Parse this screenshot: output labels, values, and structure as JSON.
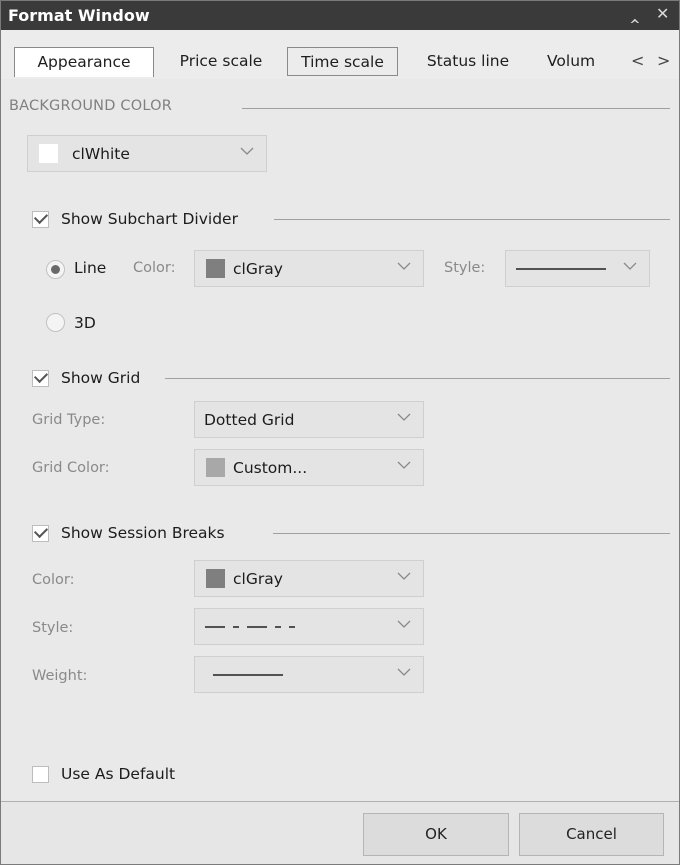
{
  "window": {
    "title": "Format Window"
  },
  "titlebar_icons": [
    "chevron-up-icon",
    "close-icon"
  ],
  "tabs": [
    {
      "label": "Appearance",
      "state": "active"
    },
    {
      "label": "Price scale",
      "state": "normal"
    },
    {
      "label": "Time scale",
      "state": "boxed"
    },
    {
      "label": "Status line",
      "state": "normal"
    },
    {
      "label": "Volum",
      "state": "normal"
    }
  ],
  "tab_nav_icons": [
    "chevron-left-icon",
    "chevron-right-icon"
  ],
  "background": {
    "caption": "BACKGROUND COLOR",
    "color_value": "clWhite",
    "swatch_color": "#ffffff"
  },
  "subchart_divider": {
    "label": "Show Subchart Divider",
    "checked": true,
    "line_option": "Line",
    "option_3d": "3D",
    "selected": "Line",
    "color_label": "Color:",
    "color_value": "clGray",
    "swatch_color": "#7f7f7f",
    "style_label": "Style:",
    "style_value": "solid"
  },
  "grid": {
    "label": "Show Grid",
    "checked": true,
    "type_label": "Grid Type:",
    "type_value": "Dotted Grid",
    "color_label": "Grid Color:",
    "color_value": "Custom...",
    "swatch_color": "#a8a8a8"
  },
  "session_breaks": {
    "label": "Show Session Breaks",
    "checked": true,
    "color_label": "Color:",
    "color_value": "clGray",
    "swatch_color": "#7f7f7f",
    "style_label": "Style:",
    "style_value": "dash-dot",
    "weight_label": "Weight:",
    "weight_value": "thin"
  },
  "use_as_default": {
    "label": "Use As Default",
    "checked": false
  },
  "buttons": {
    "ok": "OK",
    "cancel": "Cancel"
  }
}
